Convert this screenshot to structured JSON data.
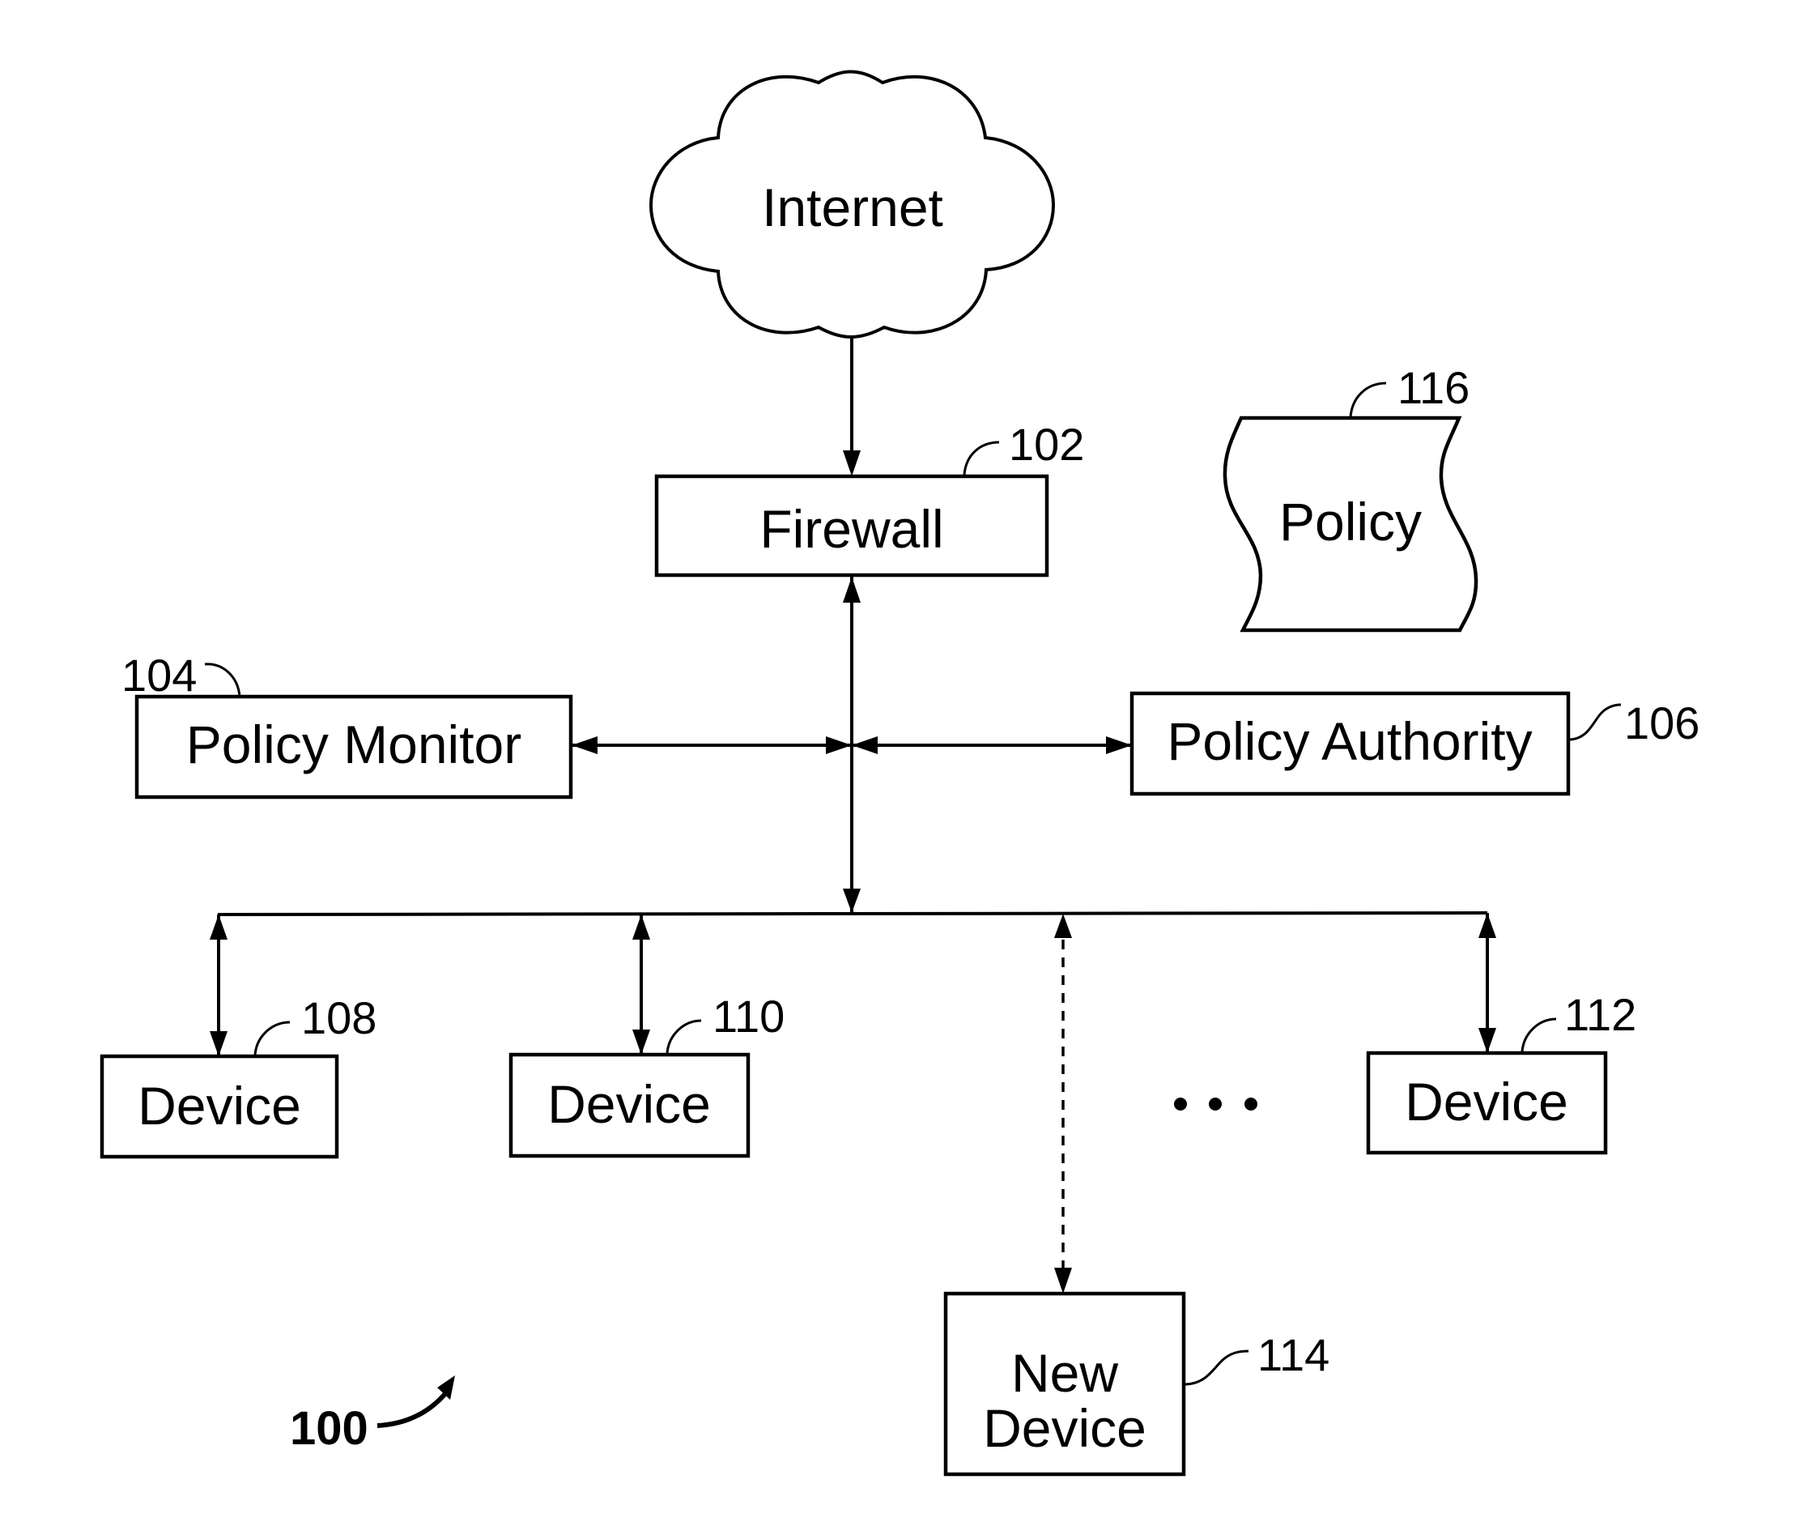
{
  "figure": {
    "number": "100",
    "nodes": {
      "internet": {
        "label": "Internet",
        "shape": "cloud"
      },
      "firewall": {
        "label": "Firewall",
        "ref": "102"
      },
      "policy_monitor": {
        "label": "Policy Monitor",
        "ref": "104"
      },
      "policy_authority": {
        "label": "Policy Authority",
        "ref": "106"
      },
      "device_108": {
        "label": "Device",
        "ref": "108"
      },
      "device_110": {
        "label": "Device",
        "ref": "110"
      },
      "device_112": {
        "label": "Device",
        "ref": "112"
      },
      "new_device": {
        "label_line1": "New",
        "label_line2": "Device",
        "ref": "114",
        "connection": "dashed"
      },
      "policy": {
        "label": "Policy",
        "ref": "116",
        "shape": "document"
      }
    },
    "ellipsis": "• • •",
    "edges": [
      {
        "from": "Internet",
        "to": "Firewall",
        "direction": "one-way"
      },
      {
        "from": "Firewall",
        "to": "network bus",
        "direction": "two-way"
      },
      {
        "from": "network trunk",
        "to": "Policy Monitor",
        "direction": "two-way"
      },
      {
        "from": "network trunk",
        "to": "Policy Authority",
        "direction": "two-way"
      },
      {
        "from": "network bus",
        "to": "Device 108",
        "direction": "two-way"
      },
      {
        "from": "network bus",
        "to": "Device 110",
        "direction": "two-way"
      },
      {
        "from": "network bus",
        "to": "Device 112",
        "direction": "two-way"
      },
      {
        "from": "network bus",
        "to": "New Device 114",
        "direction": "two-way",
        "style": "dashed"
      }
    ]
  }
}
